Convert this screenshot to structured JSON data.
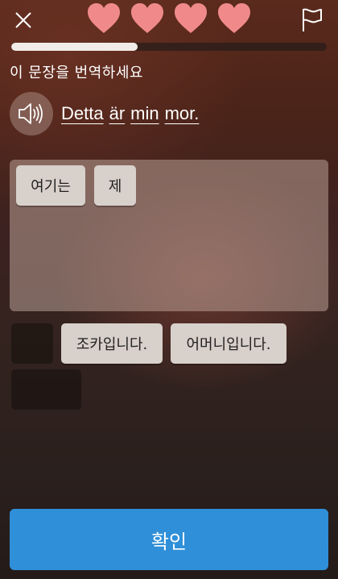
{
  "header": {
    "close_icon": "close-x-icon",
    "hearts_count": 4,
    "heart_icon": "heart-icon",
    "heart_color": "#f08a8a",
    "flag_icon": "flag-icon",
    "progress_fraction": 0.4
  },
  "exercise": {
    "instruction": "이 문장을 번역하세요",
    "speaker_icon": "speaker-icon",
    "sentence_words": [
      "Detta",
      "är",
      "min",
      "mor."
    ]
  },
  "answer": {
    "selected_tiles": [
      "여기는",
      "제"
    ]
  },
  "word_bank": {
    "tiles": [
      "조카입니다.",
      "어머니입니다."
    ]
  },
  "footer": {
    "confirm_label": "확인",
    "confirm_color": "#2f8fd8"
  }
}
